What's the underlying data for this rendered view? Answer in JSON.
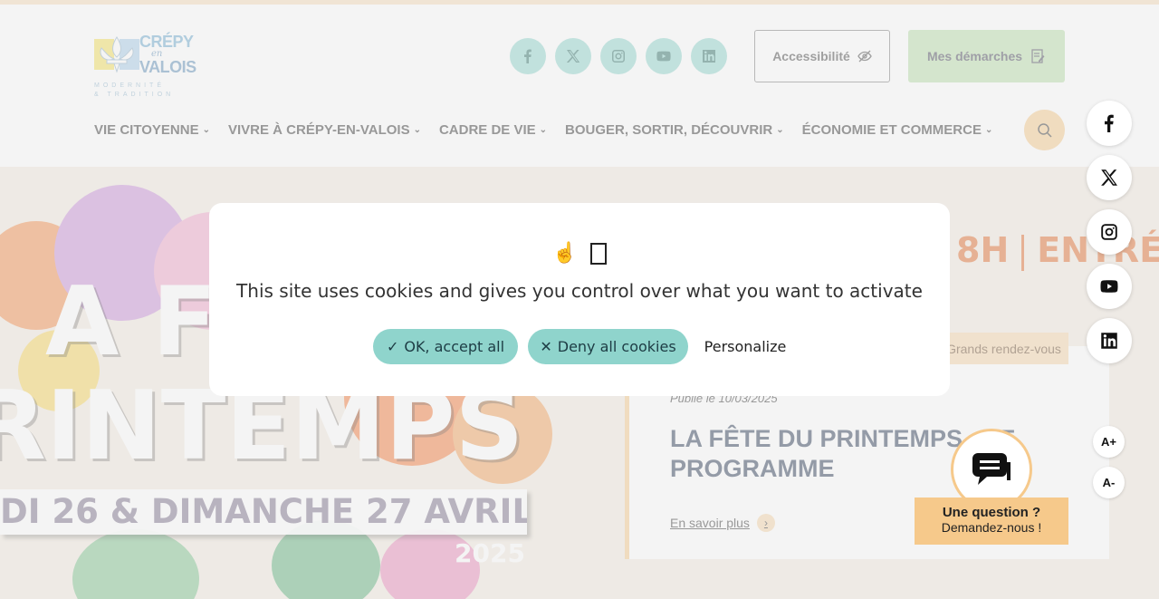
{
  "colors": {
    "accent_teal": "#8fd4cc",
    "accent_peach": "#f6c98b",
    "accent_green": "#b8dda8",
    "title_navy": "#2b3a55",
    "event_orange": "#e06a2a"
  },
  "logo": {
    "name_line1": "CRÉPY",
    "name_en": "en",
    "name_line2": "VALOIS",
    "tagline1": "MODERNITÉ",
    "tagline2": "& TRADITION"
  },
  "header": {
    "social_icons": [
      "facebook-icon",
      "x-icon",
      "instagram-icon",
      "youtube-icon",
      "linkedin-icon"
    ],
    "accessibility_label": "Accessibilité",
    "demarches_label": "Mes démarches"
  },
  "nav": {
    "items": [
      {
        "label": "VIE CITOYENNE"
      },
      {
        "label": "VIVRE À CRÉPY-EN-VALOIS"
      },
      {
        "label": "CADRE DE VIE"
      },
      {
        "label": "BOUGER, SORTIR, DÉCOUVRIR"
      },
      {
        "label": "ÉCONOMIE ET COMMERCE"
      }
    ]
  },
  "hero": {
    "poster_title_line1": "A FÊTE",
    "poster_title_line2": "RINTEMPS",
    "poster_dates": "DI 26 & DIMANCHE 27 AVRIL",
    "poster_year": "2025",
    "event_hours": "8H",
    "event_entry": "ENTRÉE",
    "card": {
      "tag": "Grands rendez-vous",
      "date": "Publié le 10/03/2025",
      "title": "LA FÊTE DU PRINTEMPS : LE PROGRAMME",
      "link": "En savoir plus"
    }
  },
  "chat": {
    "title": "Une question ?",
    "subtitle": "Demandez-nous !"
  },
  "rail": {
    "icons": [
      "facebook-icon",
      "x-icon",
      "instagram-icon",
      "youtube-icon",
      "linkedin-icon"
    ],
    "font_increase": "A+",
    "font_decrease": "A-"
  },
  "cookie": {
    "message": "This site uses cookies and gives you control over what you want to activate",
    "accept_label": "OK, accept all",
    "deny_label": "Deny all cookies",
    "personalize_label": "Personalize"
  }
}
